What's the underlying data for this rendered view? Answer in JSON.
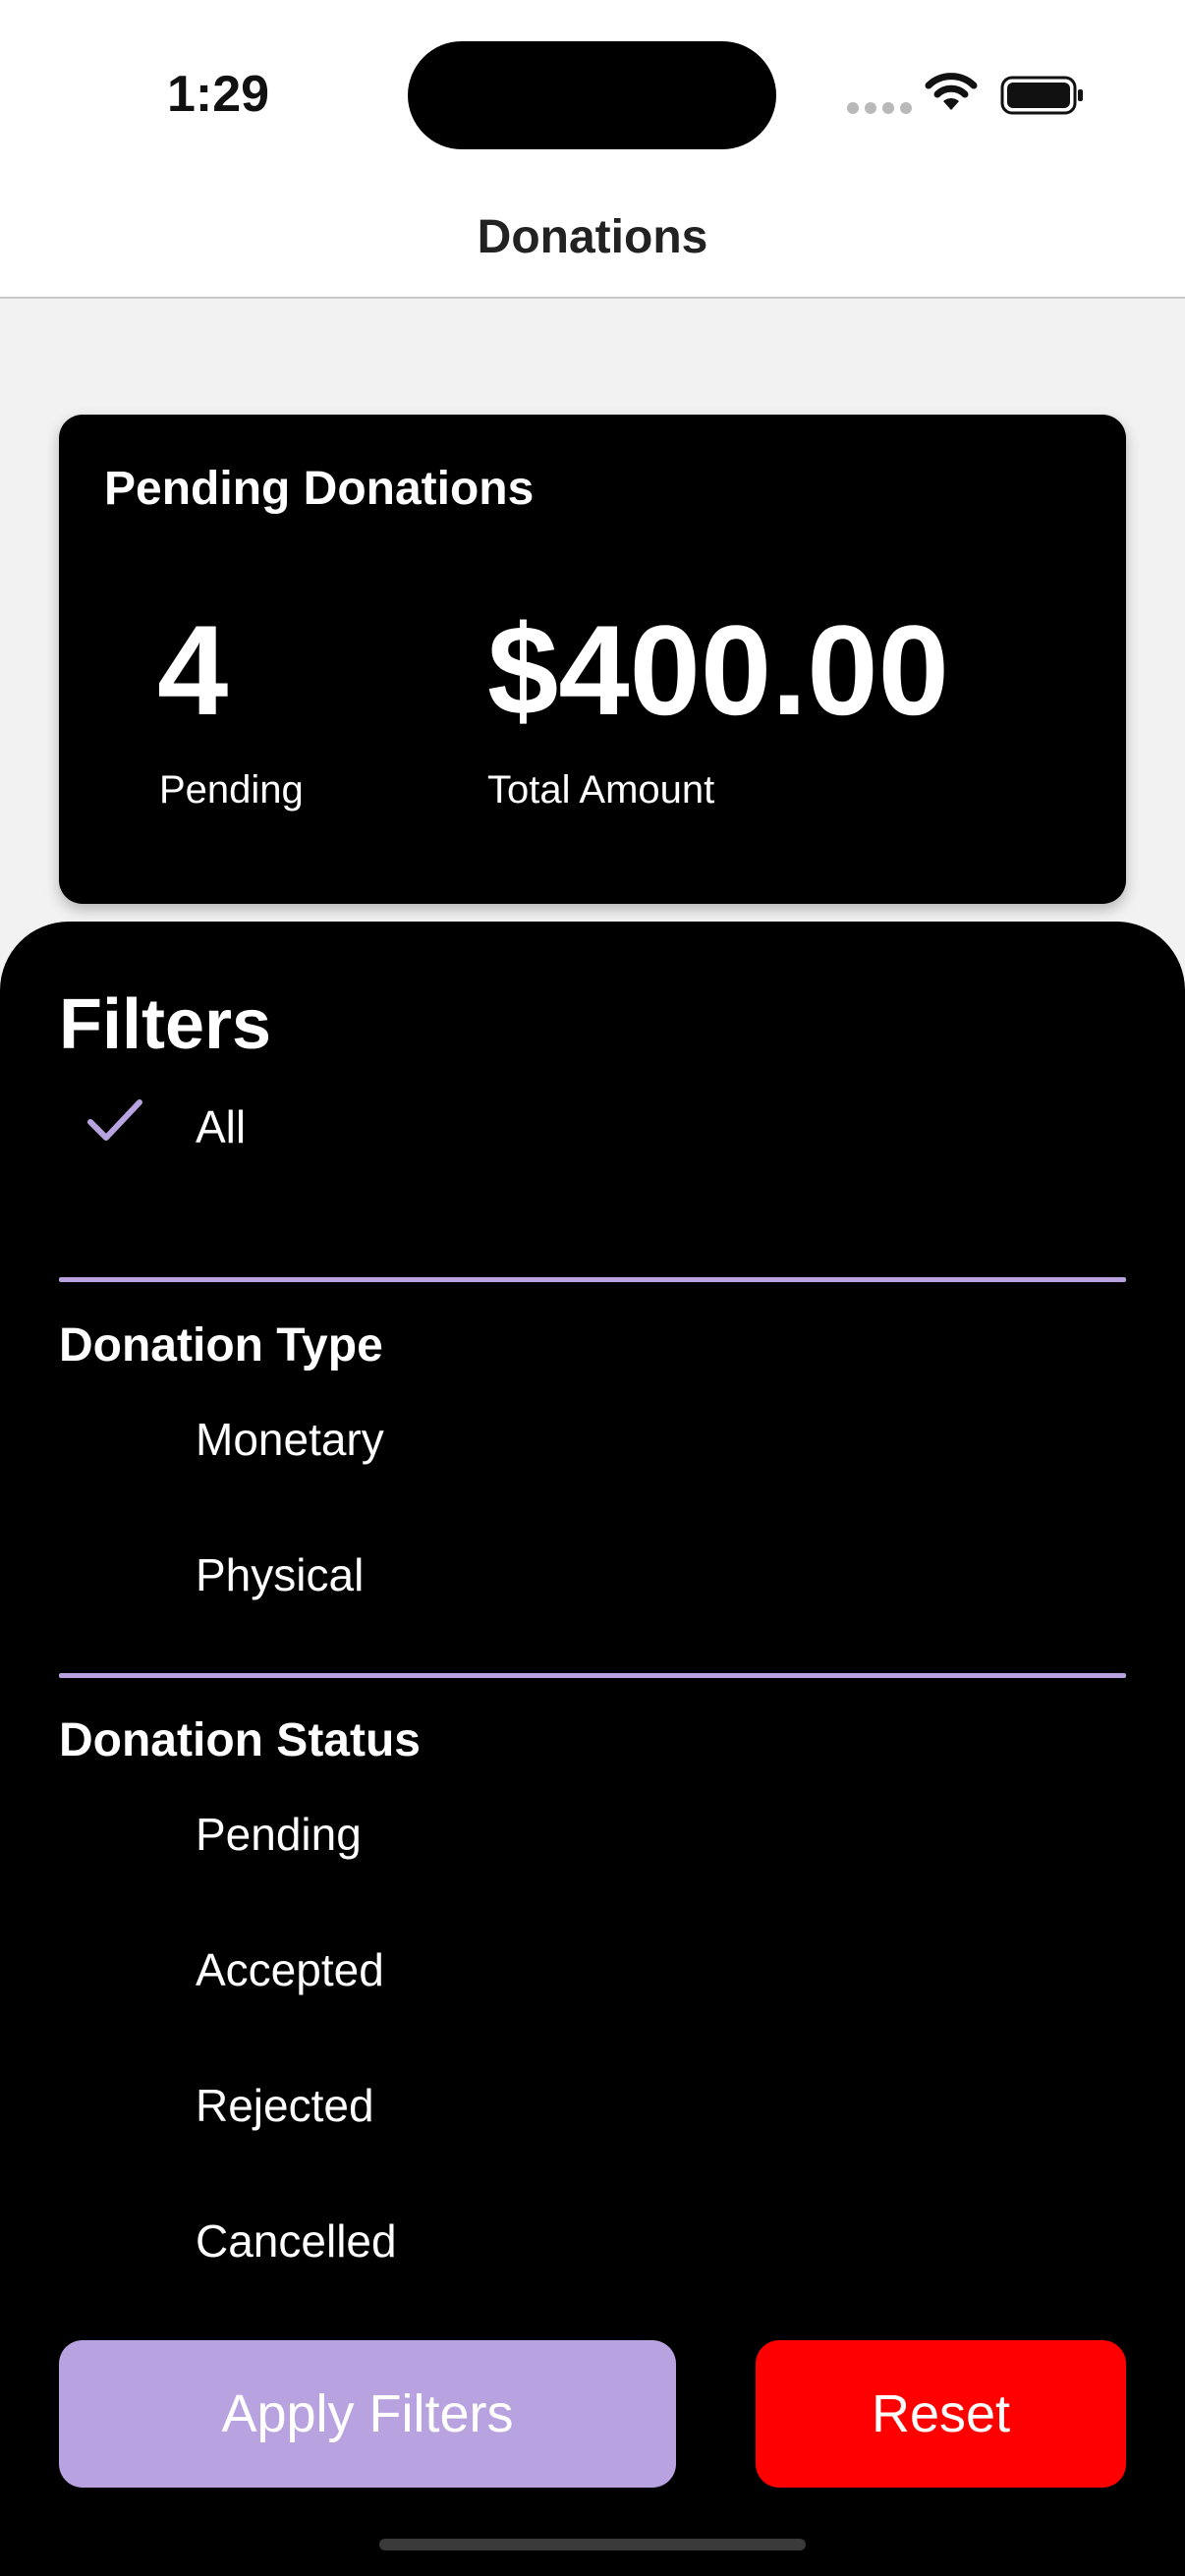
{
  "status_bar": {
    "time": "1:29",
    "icons": [
      "signal-dots-icon",
      "wifi-icon",
      "battery-icon"
    ]
  },
  "nav": {
    "title": "Donations"
  },
  "summary": {
    "title": "Pending Donations",
    "pending_count": "4",
    "pending_label": "Pending",
    "total_amount": "$400.00",
    "total_label": "Total Amount"
  },
  "filters": {
    "title": "Filters",
    "all": {
      "label": "All",
      "selected": true
    },
    "donation_type": {
      "header": "Donation Type",
      "options": [
        {
          "label": "Monetary",
          "selected": false
        },
        {
          "label": "Physical",
          "selected": false
        }
      ]
    },
    "donation_status": {
      "header": "Donation Status",
      "options": [
        {
          "label": "Pending",
          "selected": false
        },
        {
          "label": "Accepted",
          "selected": false
        },
        {
          "label": "Rejected",
          "selected": false
        },
        {
          "label": "Cancelled",
          "selected": false
        }
      ]
    },
    "apply_label": "Apply Filters",
    "reset_label": "Reset"
  },
  "colors": {
    "accent": "#b8a2e0",
    "reset": "#ff0000",
    "sheet_bg": "#000000",
    "page_bg": "#f2f2f2"
  }
}
